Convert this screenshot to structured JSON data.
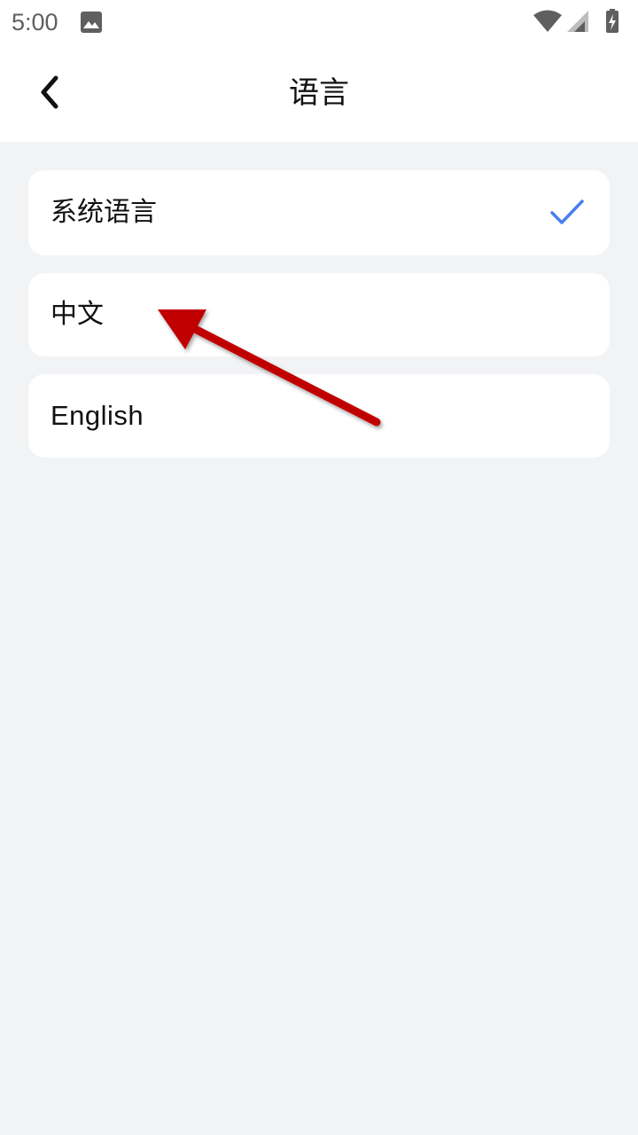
{
  "status_bar": {
    "time": "5:00",
    "icons": [
      "gallery-icon",
      "wifi-icon",
      "cellular-signal-icon",
      "battery-charging-icon"
    ]
  },
  "header": {
    "title": "语言",
    "back_icon": "chevron-left-icon"
  },
  "languages": [
    {
      "label": "系统语言",
      "selected": true
    },
    {
      "label": "中文",
      "selected": false
    },
    {
      "label": "English",
      "selected": false
    }
  ],
  "colors": {
    "accent": "#4a7ef0",
    "annotation_arrow": "#c00000",
    "background": "#f2f3f5"
  }
}
